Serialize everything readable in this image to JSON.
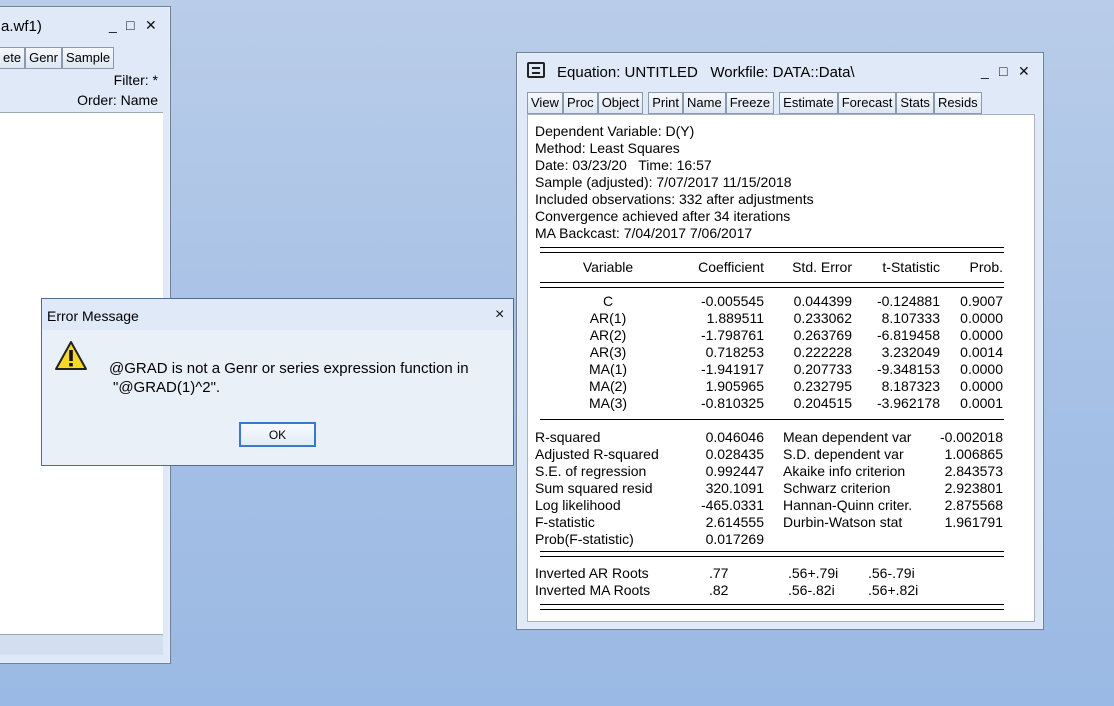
{
  "left_window": {
    "title": "a.wf1)",
    "toolbar": [
      "ete",
      "Genr",
      "Sample"
    ],
    "filter": "Filter: *",
    "order": "Order: Name"
  },
  "equation_window": {
    "title": "Equation: UNTITLED   Workfile: DATA::Data\\",
    "toolbar": [
      "View",
      "Proc",
      "Object",
      "Print",
      "Name",
      "Freeze",
      "Estimate",
      "Forecast",
      "Stats",
      "Resids"
    ],
    "header_lines": [
      "Dependent Variable: D(Y)",
      "Method: Least Squares",
      "Date: 03/23/20   Time: 16:57",
      "Sample (adjusted): 7/07/2017 11/15/2018",
      "Included observations: 332 after adjustments",
      "Convergence achieved after 34 iterations",
      "MA Backcast: 7/04/2017 7/06/2017"
    ],
    "columns": [
      "Variable",
      "Coefficient",
      "Std. Error",
      "t-Statistic",
      "Prob."
    ],
    "rows": [
      [
        "C",
        "-0.005545",
        "0.044399",
        "-0.124881",
        "0.9007"
      ],
      [
        "AR(1)",
        "1.889511",
        "0.233062",
        "8.107333",
        "0.0000"
      ],
      [
        "AR(2)",
        "-1.798761",
        "0.263769",
        "-6.819458",
        "0.0000"
      ],
      [
        "AR(3)",
        "0.718253",
        "0.222228",
        "3.232049",
        "0.0014"
      ],
      [
        "MA(1)",
        "-1.941917",
        "0.207733",
        "-9.348153",
        "0.0000"
      ],
      [
        "MA(2)",
        "1.905965",
        "0.232795",
        "8.187323",
        "0.0000"
      ],
      [
        "MA(3)",
        "-0.810325",
        "0.204515",
        "-3.962178",
        "0.0001"
      ]
    ],
    "stats": [
      [
        "R-squared",
        "0.046046",
        "Mean dependent var",
        "-0.002018"
      ],
      [
        "Adjusted R-squared",
        "0.028435",
        "S.D. dependent var",
        "1.006865"
      ],
      [
        "S.E. of regression",
        "0.992447",
        "Akaike info criterion",
        "2.843573"
      ],
      [
        "Sum squared resid",
        "320.1091",
        "Schwarz criterion",
        "2.923801"
      ],
      [
        "Log likelihood",
        "-465.0331",
        "Hannan-Quinn criter.",
        "2.875568"
      ],
      [
        "F-statistic",
        "2.614555",
        "Durbin-Watson stat",
        "1.961791"
      ],
      [
        "Prob(F-statistic)",
        "0.017269",
        "",
        ""
      ]
    ],
    "roots": [
      [
        "Inverted AR Roots",
        ".77",
        ".56+.79i",
        ".56-.79i"
      ],
      [
        "Inverted MA Roots",
        ".82",
        ".56-.82i",
        ".56+.82i"
      ]
    ]
  },
  "error_dialog": {
    "title": "Error Message",
    "message_line1": "@GRAD is not a Genr or series expression function in",
    "message_line2": "\"@GRAD(1)^2\".",
    "ok_label": "OK",
    "close": "×"
  },
  "controls": {
    "minimize": "_",
    "maximize": "□",
    "close": "✕"
  }
}
